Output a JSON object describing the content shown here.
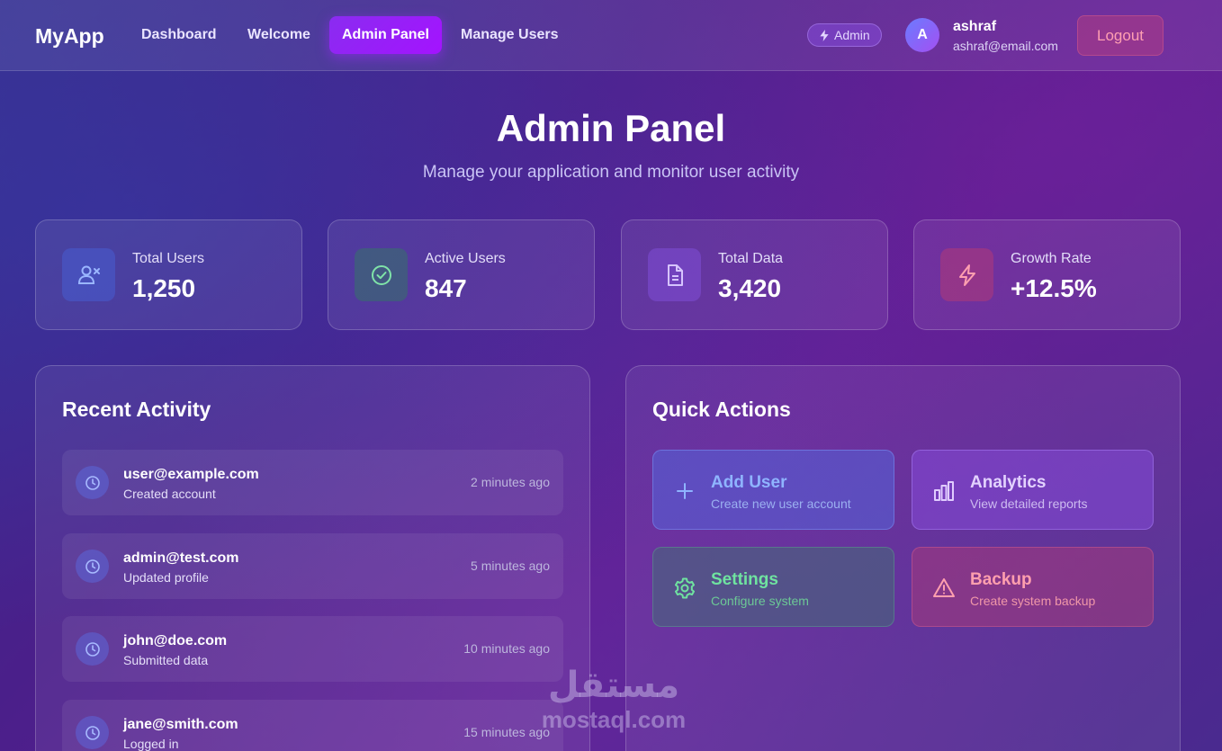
{
  "nav": {
    "brand": "MyApp",
    "links": [
      "Dashboard",
      "Welcome",
      "Admin Panel",
      "Manage Users"
    ],
    "active": "Admin Panel",
    "role_badge": "Admin",
    "user": {
      "initial": "A",
      "name": "ashraf",
      "email": "ashraf@email.com"
    },
    "logout_label": "Logout"
  },
  "header": {
    "title": "Admin Panel",
    "subtitle": "Manage your application and monitor user activity"
  },
  "stats": [
    {
      "label": "Total Users",
      "value": "1,250",
      "icon": "users-icon",
      "color": "#4a6bd8"
    },
    {
      "label": "Active Users",
      "value": "847",
      "icon": "check-circle-icon",
      "color": "#3d8a6e"
    },
    {
      "label": "Total Data",
      "value": "3,420",
      "icon": "document-icon",
      "color": "#7a4cd6"
    },
    {
      "label": "Growth Rate",
      "value": "+12.5%",
      "icon": "lightning-icon",
      "color": "#b23c6b"
    }
  ],
  "activity": {
    "title": "Recent Activity",
    "items": [
      {
        "user": "user@example.com",
        "action": "Created account",
        "time": "2 minutes ago"
      },
      {
        "user": "admin@test.com",
        "action": "Updated profile",
        "time": "5 minutes ago"
      },
      {
        "user": "john@doe.com",
        "action": "Submitted data",
        "time": "10 minutes ago"
      },
      {
        "user": "jane@smith.com",
        "action": "Logged in",
        "time": "15 minutes ago"
      }
    ]
  },
  "quick_actions": {
    "title": "Quick Actions",
    "items": [
      {
        "label": "Add User",
        "desc": "Create new user account",
        "icon": "plus-icon",
        "color": "#8fb4ff"
      },
      {
        "label": "Analytics",
        "desc": "View detailed reports",
        "icon": "bar-chart-icon",
        "color": "#d9c4ff"
      },
      {
        "label": "Settings",
        "desc": "Configure system",
        "icon": "gear-icon",
        "color": "#6fe3a0"
      },
      {
        "label": "Backup",
        "desc": "Create system backup",
        "icon": "warning-icon",
        "color": "#ff9fae"
      }
    ]
  },
  "watermark": {
    "arabic": "مستقل",
    "latin": "mostaql.com"
  }
}
